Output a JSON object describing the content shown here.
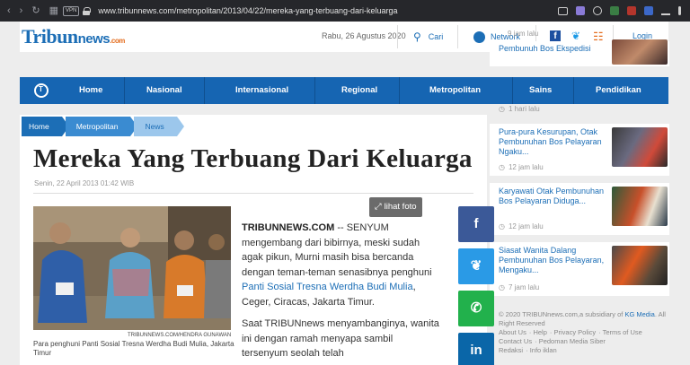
{
  "browser": {
    "url": "www.tribunnews.com/metropolitan/2013/04/22/mereka-yang-terbuang-dari-keluarga",
    "vpn_label": "VPN"
  },
  "header": {
    "logo_main": "Tribun",
    "logo_sub": "news",
    "logo_tld": ".com",
    "date": "Rabu, 26 Agustus 2020",
    "search_label": "Cari",
    "network_label": "Network",
    "login_label": "Login"
  },
  "nav": {
    "items": [
      "Home",
      "Nasional",
      "Internasional",
      "Regional",
      "Metropolitan",
      "Sains",
      "Pendidikan"
    ]
  },
  "breadcrumb": [
    "Home",
    "Metropolitan",
    "News"
  ],
  "article": {
    "title": "Mereka Yang Terbuang Dari Keluarga",
    "byline": "Senin, 22 April 2013 01:42 WIB",
    "lihat_foto": "lihat foto",
    "photo_credit": "TRIBUNNEWS.COM/HENDRA GUNAWAN",
    "caption": "Para penghuni Panti Sosial Tresna Werdha Budi Mulia, Jakarta Timur",
    "source": "TRIBUNNEWS.COM",
    "p1_a": " -- SENYUM mengembang dari bibirnya, meski sudah agak pikun, Murni masih bisa bercanda dengan teman-teman senasibnya penghuni ",
    "p1_link": "Panti Sosial Tresna Werdha Budi Mulia",
    "p1_b": ", Ceger, Ciracas, Jakarta Timur.",
    "p2": "Saat TRIBUNnews menyambanginya, wanita ini dengan ramah menyapa sambil tersenyum seolah telah"
  },
  "share": {
    "facebook": "f",
    "twitter": "t",
    "whatsapp": "w",
    "linkedin": "in"
  },
  "sidebar": {
    "top_time": "9 jam lalu",
    "items": [
      {
        "title": "Pembunuh Bos Ekspedisi",
        "time": "1 hari lalu"
      },
      {
        "title": "Pura-pura Kesurupan, Otak Pembunuhan Bos Pelayaran Ngaku...",
        "time": "12 jam lalu"
      },
      {
        "title": "Karyawati Otak Pembunuhan Bos Pelayaran Diduga...",
        "time": "12 jam lalu"
      },
      {
        "title": "Siasat Wanita Dalang Pembunuhan Bos Pelayaran, Mengaku...",
        "time": "7 jam lalu"
      }
    ]
  },
  "footer": {
    "copyright": "© 2020 TRIBUNnews.com,a subsidiary of",
    "kg": "KG Media",
    "rights": ". All Right Reserved",
    "links1": [
      "About Us",
      "Help",
      "Privacy Policy",
      "Terms of Use"
    ],
    "links2": [
      "Contact Us",
      "Pedoman Media Siber"
    ],
    "links3": [
      "Redaksi",
      "Info iklan"
    ]
  },
  "colors": {
    "brand_blue": "#1665b2",
    "facebook": "#3b5998",
    "twitter": "#2a9ae6",
    "whatsapp": "#22b14c",
    "linkedin": "#0a66a8"
  }
}
